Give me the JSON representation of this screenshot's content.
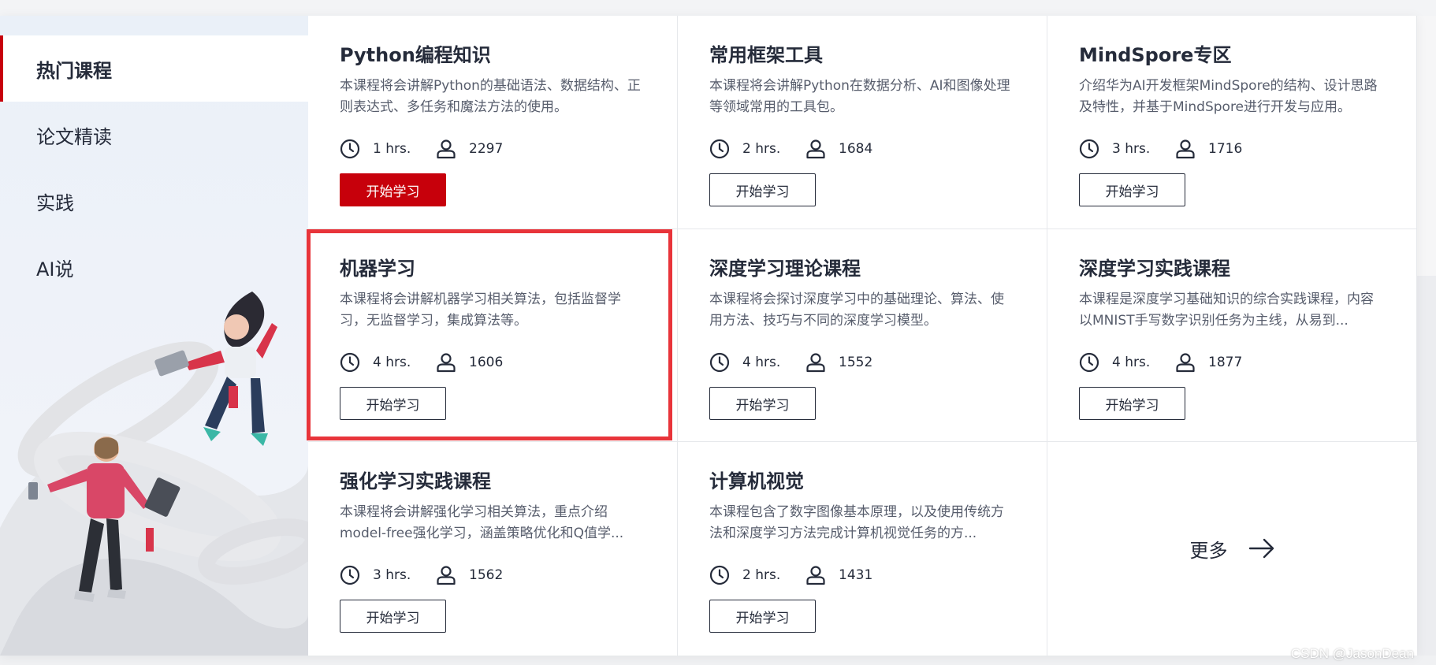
{
  "sidebar": {
    "items": [
      {
        "label": "热门课程"
      },
      {
        "label": "论文精读"
      },
      {
        "label": "实践"
      },
      {
        "label": "AI说"
      }
    ]
  },
  "courses": [
    {
      "title": "Python编程知识",
      "desc": "本课程将会讲解Python的基础语法、数据结构、正则表达式、多任务和魔法方法的使用。",
      "hours": "1 hrs.",
      "learners": "2297",
      "button": "开始学习"
    },
    {
      "title": "常用框架工具",
      "desc": "本课程将会讲解Python在数据分析、AI和图像处理等领域常用的工具包。",
      "hours": "2 hrs.",
      "learners": "1684",
      "button": "开始学习"
    },
    {
      "title": "MindSpore专区",
      "desc": "介绍华为AI开发框架MindSpore的结构、设计思路及特性，并基于MindSpore进行开发与应用。",
      "hours": "3 hrs.",
      "learners": "1716",
      "button": "开始学习"
    },
    {
      "title": "机器学习",
      "desc": "本课程将会讲解机器学习相关算法，包括监督学习，无监督学习，集成算法等。",
      "hours": "4 hrs.",
      "learners": "1606",
      "button": "开始学习"
    },
    {
      "title": "深度学习理论课程",
      "desc": "本课程将会探讨深度学习中的基础理论、算法、使用方法、技巧与不同的深度学习模型。",
      "hours": "4 hrs.",
      "learners": "1552",
      "button": "开始学习"
    },
    {
      "title": "深度学习实践课程",
      "desc": "本课程是深度学习基础知识的综合实践课程，内容以MNIST手写数字识别任务为主线，从易到...",
      "hours": "4 hrs.",
      "learners": "1877",
      "button": "开始学习"
    },
    {
      "title": "强化学习实践课程",
      "desc": "本课程将会讲解强化学习相关算法，重点介绍model-free强化学习，涵盖策略优化和Q值学...",
      "hours": "3 hrs.",
      "learners": "1562",
      "button": "开始学习"
    },
    {
      "title": "计算机视觉",
      "desc": "本课程包含了数字图像基本原理，以及使用传统方法和深度学习方法完成计算机视觉任务的方...",
      "hours": "2 hrs.",
      "learners": "1431",
      "button": "开始学习"
    }
  ],
  "more": {
    "label": "更多"
  },
  "watermark": "CSDN @JasonDean",
  "colors": {
    "accent": "#c7000b",
    "highlight": "#e8343a",
    "text": "#252b3a",
    "muted": "#575d6c"
  },
  "icons": {
    "time": "clock-icon",
    "learners": "user-icon",
    "more": "arrow-right-icon"
  }
}
